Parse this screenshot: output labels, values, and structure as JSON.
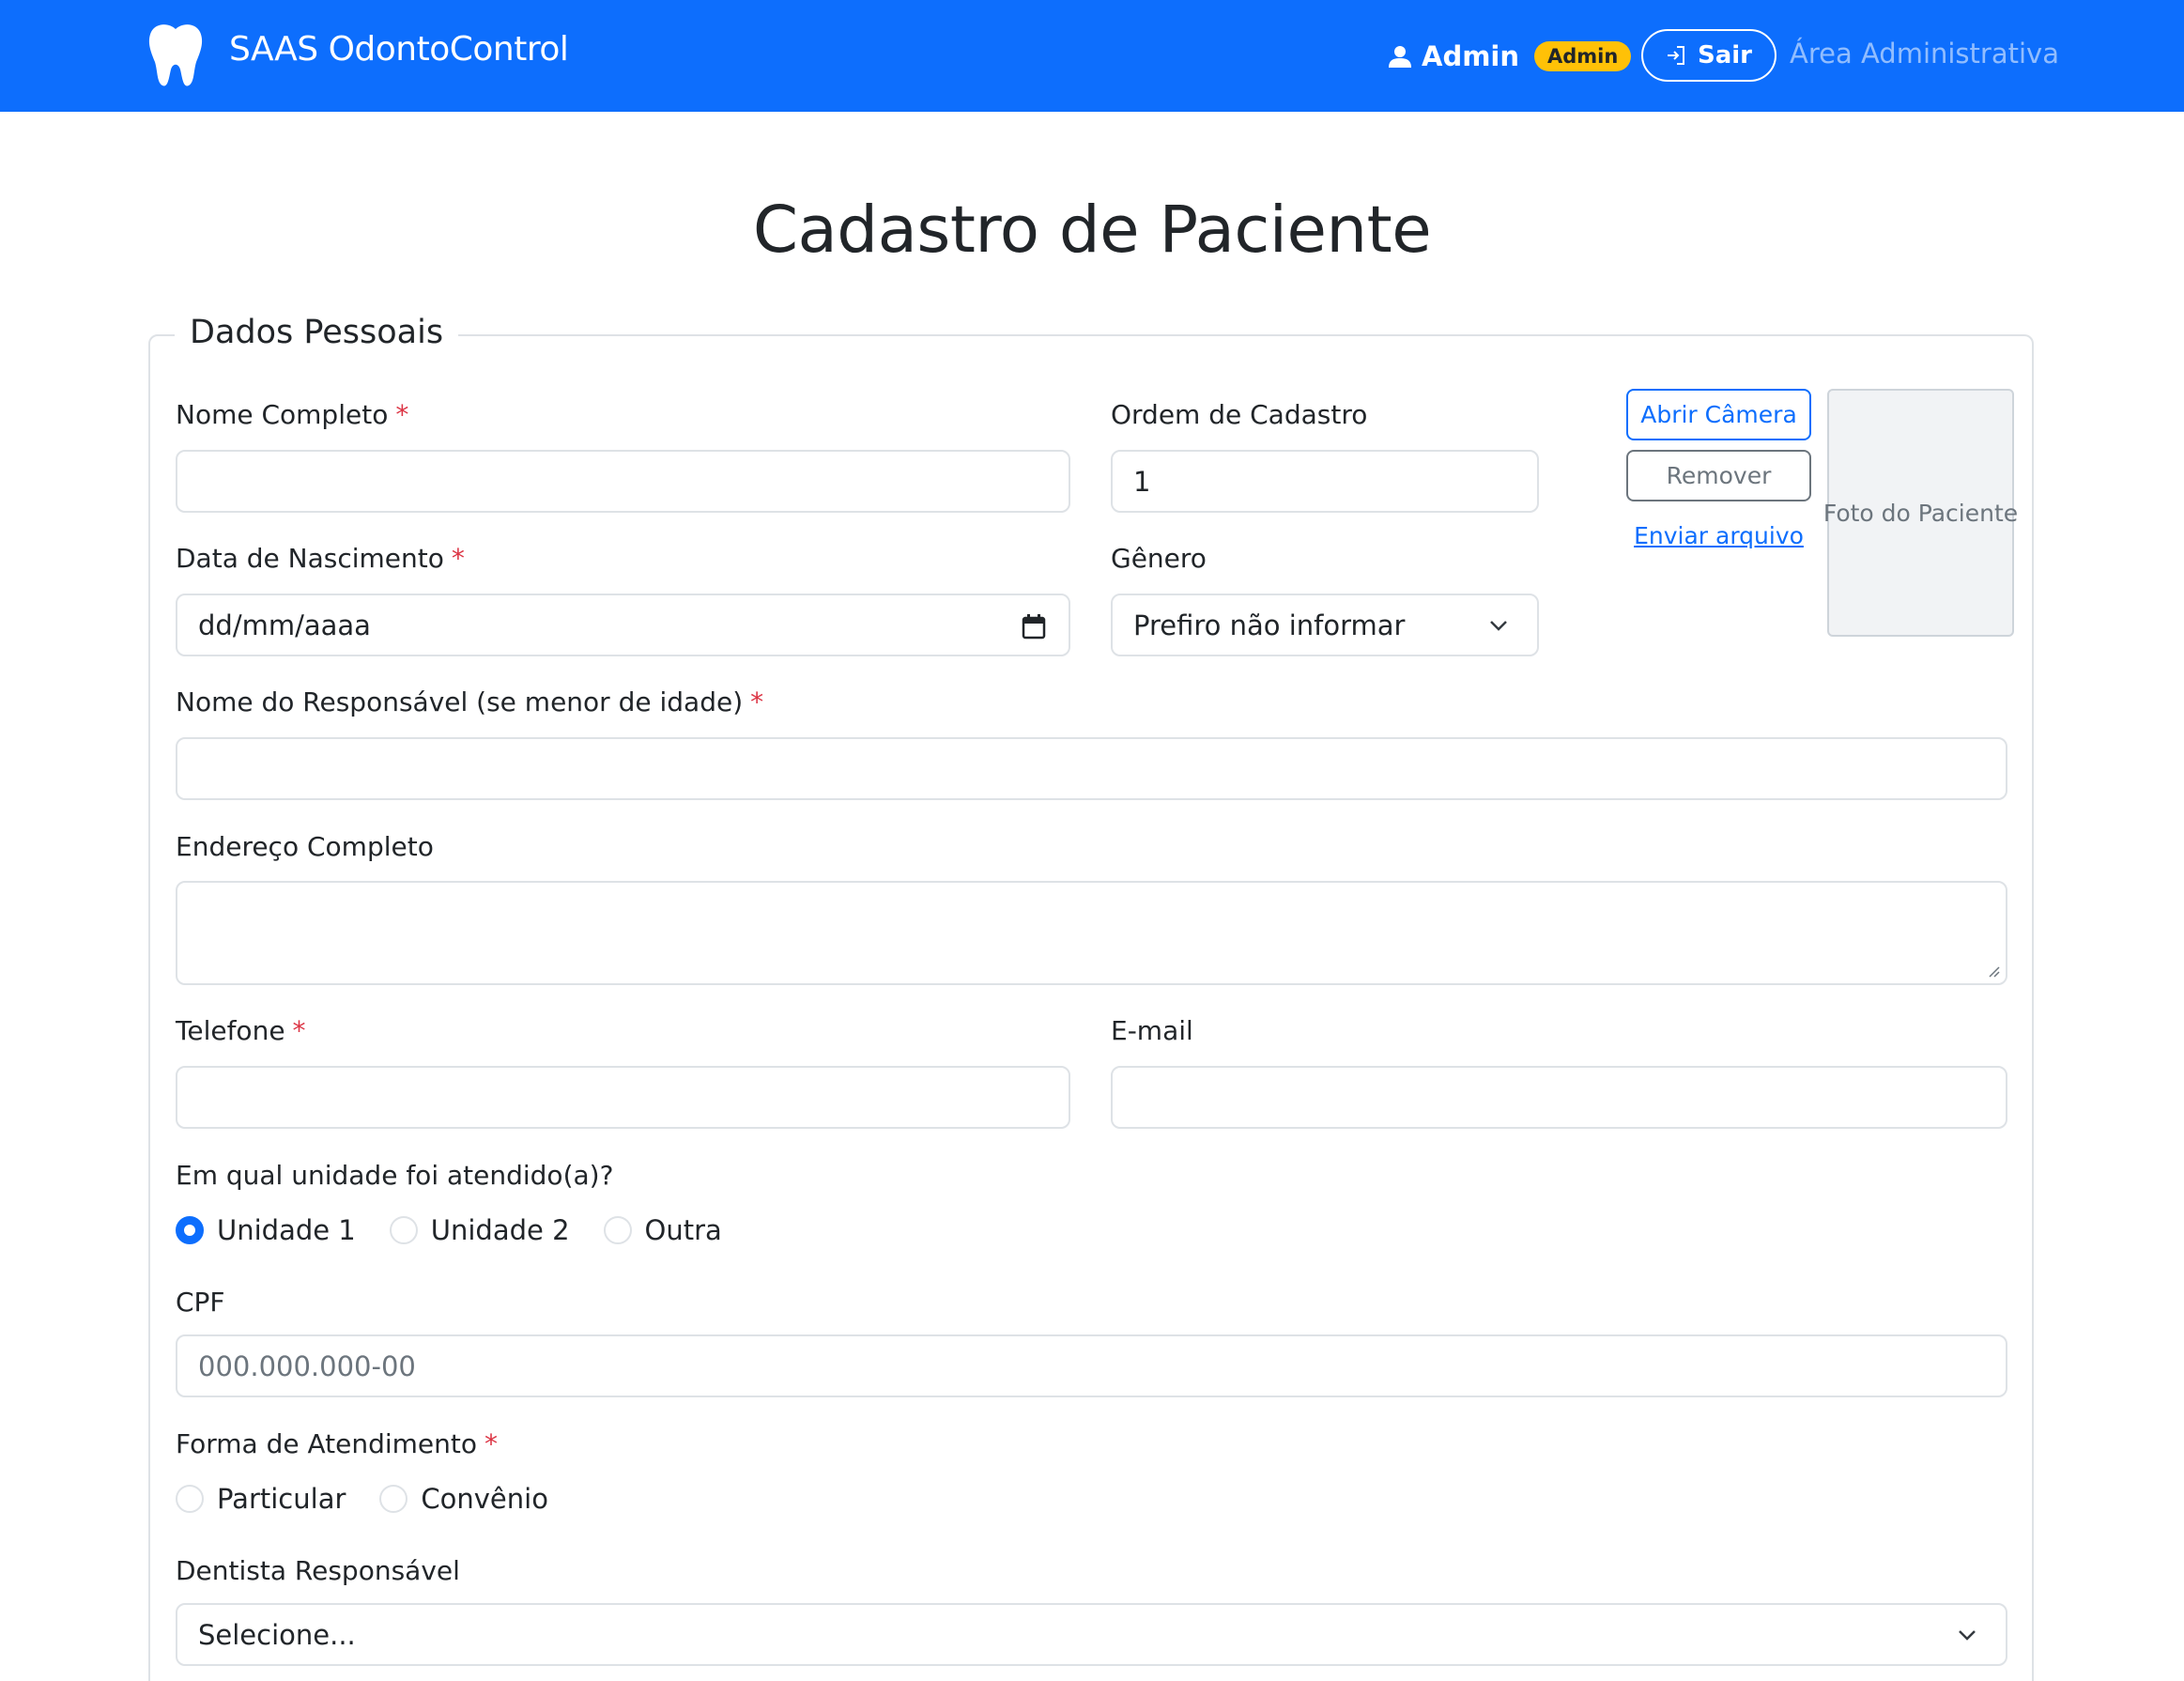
{
  "navbar": {
    "brand": "SAAS OdontoControl",
    "user_name": "Admin",
    "role_badge": "Admin",
    "logout_label": "Sair",
    "admin_link": "Área Administrativa",
    "colors": {
      "primary": "#0d6efd",
      "badge": "#ffc107"
    }
  },
  "page": {
    "title": "Cadastro de Paciente"
  },
  "form": {
    "legend": "Dados Pessoais",
    "full_name": {
      "label": "Nome Completo",
      "required_mark": "*",
      "value": ""
    },
    "order": {
      "label": "Ordem de Cadastro",
      "value": "1"
    },
    "birth_date": {
      "label": "Data de Nascimento",
      "required_mark": "*",
      "placeholder": "dd/mm/aaaa"
    },
    "gender": {
      "label": "Gênero",
      "selected": "Prefiro não informar"
    },
    "guardian": {
      "label": "Nome do Responsável (se menor de idade)",
      "required_mark": "*",
      "value": ""
    },
    "address": {
      "label": "Endereço Completo",
      "value": ""
    },
    "phone": {
      "label": "Telefone",
      "required_mark": "*",
      "value": ""
    },
    "email": {
      "label": "E-mail",
      "value": ""
    },
    "unit": {
      "label": "Em qual unidade foi atendido(a)?",
      "options": [
        "Unidade 1",
        "Unidade 2",
        "Outra"
      ],
      "selected": "Unidade 1"
    },
    "cpf": {
      "label": "CPF",
      "placeholder": "000.000.000-00"
    },
    "service_type": {
      "label": "Forma de Atendimento",
      "required_mark": "*",
      "options": [
        "Particular",
        "Convênio"
      ],
      "selected": null
    },
    "dentist": {
      "label": "Dentista Responsável",
      "selected": "Selecione..."
    }
  },
  "photo": {
    "open_camera": "Abrir Câmera",
    "remove": "Remover",
    "upload": "Enviar arquivo",
    "placeholder": "Foto do Paciente"
  }
}
